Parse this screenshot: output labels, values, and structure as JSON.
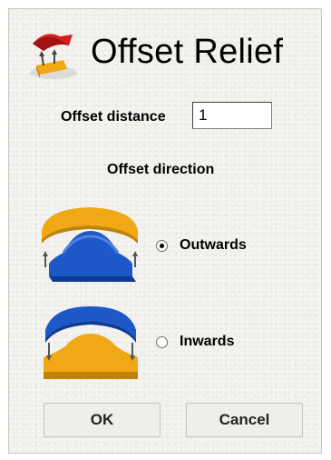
{
  "dialog": {
    "title": "Offset Relief",
    "offset_distance_label": "Offset distance",
    "offset_distance_value": "1",
    "offset_direction_label": "Offset direction",
    "options": [
      {
        "label": "Outwards",
        "checked": true,
        "icon": "offset-outwards-icon"
      },
      {
        "label": "Inwards",
        "checked": false,
        "icon": "offset-inwards-icon"
      }
    ],
    "ok_label": "OK",
    "cancel_label": "Cancel",
    "colors": {
      "orange": "#f0a814",
      "blue": "#1d58c8",
      "red": "#d81e1e",
      "panel": "#f1f0ec"
    }
  }
}
